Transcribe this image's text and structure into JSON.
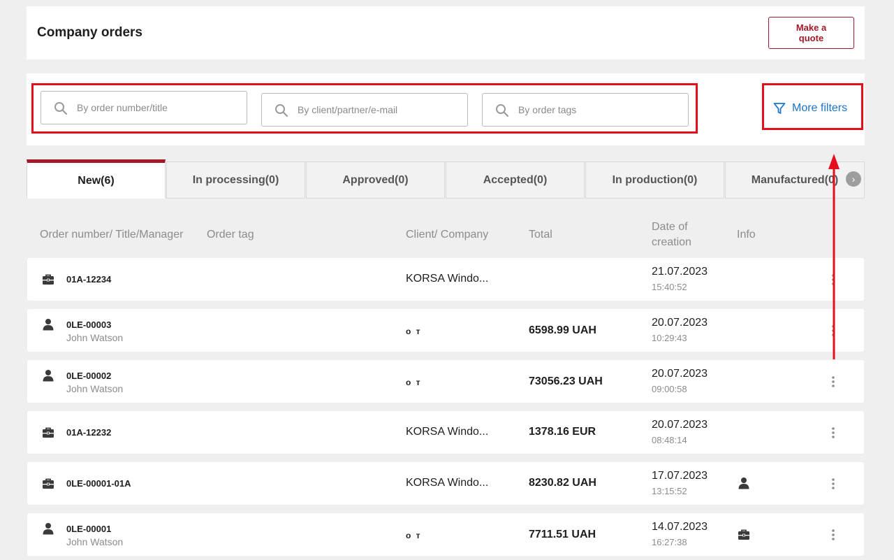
{
  "header": {
    "title": "Company orders",
    "quote_button": "Make a quote"
  },
  "filters": {
    "order_placeholder": "By order number/title",
    "client_placeholder": "By client/partner/e-mail",
    "tags_placeholder": "By order tags",
    "more_filters": "More filters"
  },
  "tabs": [
    {
      "label": "New(6)",
      "active": true
    },
    {
      "label": "In processing(0)"
    },
    {
      "label": "Approved(0)"
    },
    {
      "label": "Accepted(0)"
    },
    {
      "label": "In production(0)"
    },
    {
      "label": "Manufactured(0)"
    }
  ],
  "columns": {
    "order": "Order number/ Title/Manager",
    "tag": "Order tag",
    "client": "Client/ Company",
    "total": "Total",
    "date_line1": "Date of",
    "date_line2": "creation",
    "info": "Info"
  },
  "orders": [
    {
      "type_icon": "briefcase-icon",
      "number": "01A-12234",
      "manager": "",
      "client": "KORSA Windo...",
      "total": "",
      "date": "21.07.2023",
      "time": "15:40:52",
      "info_icon": ""
    },
    {
      "type_icon": "person-icon",
      "number": "0LE-00003",
      "manager": "John Watson",
      "client": "о т",
      "total": "6598.99 UAH",
      "date": "20.07.2023",
      "time": "10:29:43",
      "info_icon": ""
    },
    {
      "type_icon": "person-icon",
      "number": "0LE-00002",
      "manager": "John Watson",
      "client": "о т",
      "total": "73056.23 UAH",
      "date": "20.07.2023",
      "time": "09:00:58",
      "info_icon": ""
    },
    {
      "type_icon": "briefcase-icon",
      "number": "01A-12232",
      "manager": "",
      "client": "KORSA Windo...",
      "total": "1378.16 EUR",
      "date": "20.07.2023",
      "time": "08:48:14",
      "info_icon": ""
    },
    {
      "type_icon": "briefcase-icon",
      "number": "0LE-00001-01A",
      "manager": "",
      "client": "KORSA Windo...",
      "total": "8230.82 UAH",
      "date": "17.07.2023",
      "time": "13:15:52",
      "info_icon": "person-icon"
    },
    {
      "type_icon": "person-icon",
      "number": "0LE-00001",
      "manager": "John Watson",
      "client": "о т",
      "total": "7711.51 UAH",
      "date": "14.07.2023",
      "time": "16:27:38",
      "info_icon": "briefcase-icon"
    }
  ],
  "colors": {
    "accent": "#a31927",
    "link": "#1a74c8",
    "highlight": "#e3101b"
  }
}
